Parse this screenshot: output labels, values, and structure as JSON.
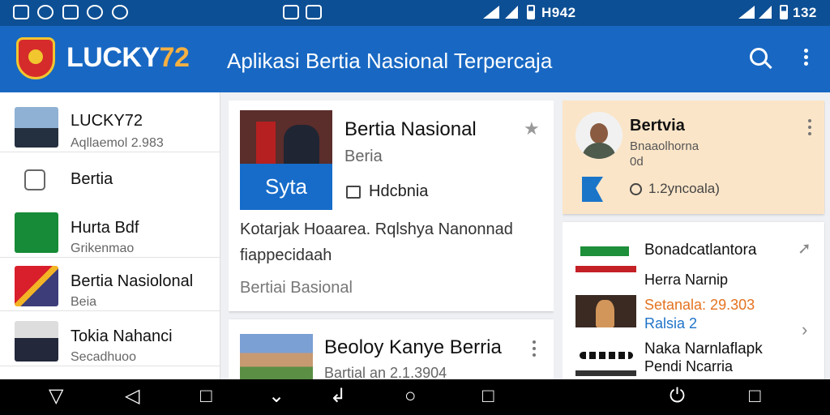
{
  "status_bar": {
    "left_time": "H942",
    "right_time": "132"
  },
  "app_bar": {
    "brand": "LUCKY",
    "brand_number": "72",
    "title": "Aplikasi Bertia Nasional Terpercaja"
  },
  "sidebar": {
    "items": [
      {
        "label": "LUCKY72",
        "sub": "Aqllaemol 2.983"
      },
      {
        "label": "Bertia",
        "sub": ""
      },
      {
        "label": "Hurta Bdf",
        "sub": "Grikenmao"
      },
      {
        "label": "Bertia Nasiolonal",
        "sub": "Beia"
      },
      {
        "label": "Tokia Nahanci",
        "sub": "Secadhuoo"
      }
    ]
  },
  "feature": {
    "badge": "Syta",
    "title": "Bertia Nasional",
    "category": "Beria",
    "meta": "Hdcbnia",
    "summary": "Kotarjak Hoaarea. Rqlshya Nanonnad fiappecidaah",
    "footer": "Bertiai Basional"
  },
  "second_story": {
    "title": "Beoloy Kanye Berria",
    "meta": "Bartial an 2.1.3904"
  },
  "profile_card": {
    "title": "Bertvia",
    "sub_line1": "Bnaaolhorna",
    "sub_line2": "0d",
    "meta": "1.2yncoala)"
  },
  "list_card": {
    "title1": "Bonadcatlantora",
    "title2": "Herra Narnip",
    "orange": "Setanala: 29.303",
    "blue": "Ralsia 2",
    "title3": "Naka Narnlaflapk",
    "title4": "Pendi Ncarria"
  },
  "colors": {
    "status_bar": "#0d4f94",
    "app_bar": "#1868c3",
    "accent_blue": "#176cc9",
    "profile_background": "#fbe5c8",
    "orange": "#e47320"
  }
}
